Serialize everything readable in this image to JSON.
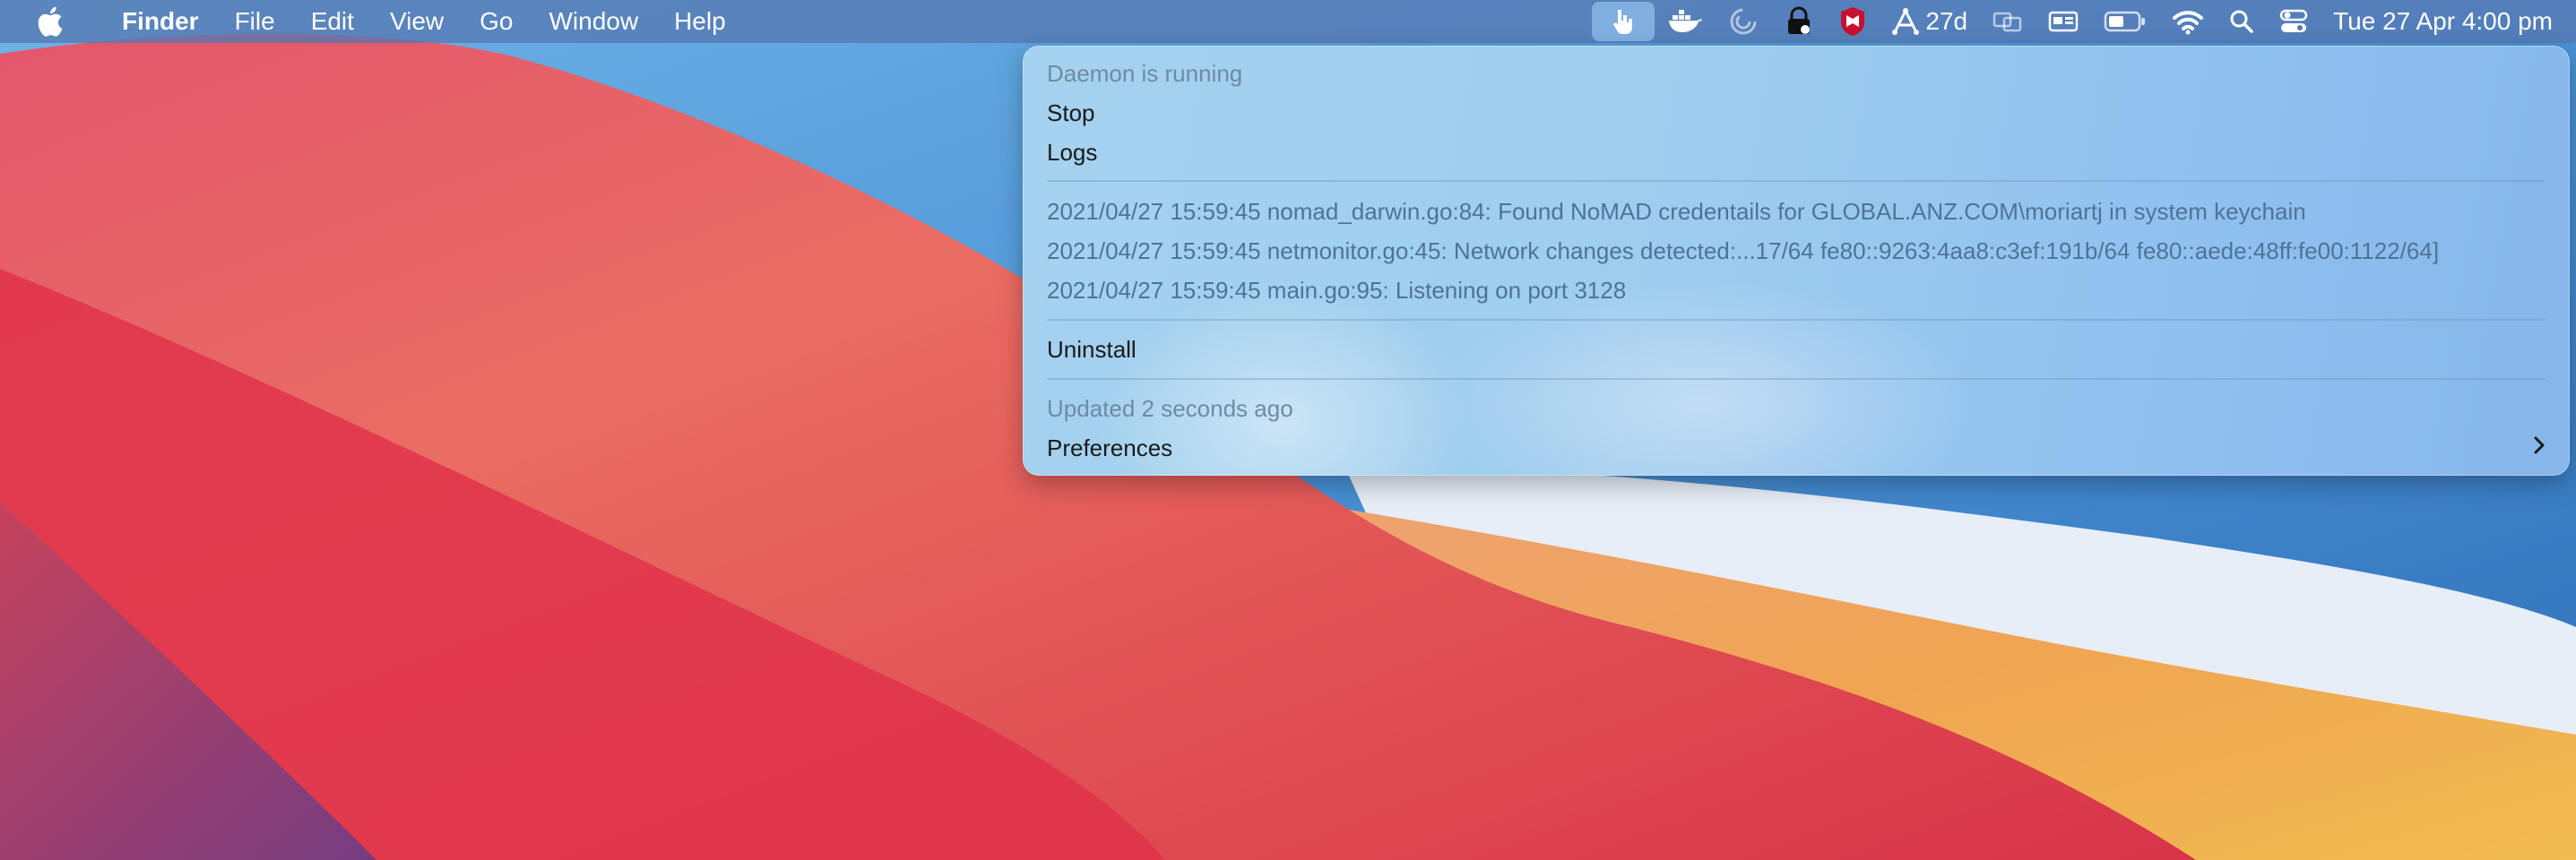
{
  "menubar": {
    "app_name": "Finder",
    "menus": [
      "File",
      "Edit",
      "View",
      "Go",
      "Window",
      "Help"
    ],
    "tray_icons": [
      "app-tray-icon",
      "docker-icon",
      "sync-icon",
      "vpn-lock-icon",
      "mcafee-icon",
      "network-icon",
      "screen-mirror-icon",
      "display-icon",
      "battery-icon",
      "wifi-icon",
      "search-icon",
      "control-center-icon"
    ],
    "network_label": "27d",
    "clock": "Tue 27 Apr  4:00 pm"
  },
  "dropdown": {
    "status": "Daemon is running",
    "stop_label": "Stop",
    "logs_label": "Logs",
    "log_lines": [
      "2021/04/27 15:59:45 nomad_darwin.go:84: Found NoMAD credentails for GLOBAL.ANZ.COM\\moriartj in system keychain",
      "2021/04/27 15:59:45 netmonitor.go:45: Network changes detected:...17/64 fe80::9263:4aa8:c3ef:191b/64 fe80::aede:48ff:fe00:1122/64]",
      "2021/04/27 15:59:45 main.go:95: Listening on port 3128"
    ],
    "uninstall_label": "Uninstall",
    "updated_text": "Updated 2 seconds ago",
    "preferences_label": "Preferences"
  },
  "colors": {
    "menubar_bg": "#5678b2",
    "dropdown_bg": "#9fcdee",
    "log_text": "#4f7398",
    "muted_text": "#6f8aa4"
  }
}
